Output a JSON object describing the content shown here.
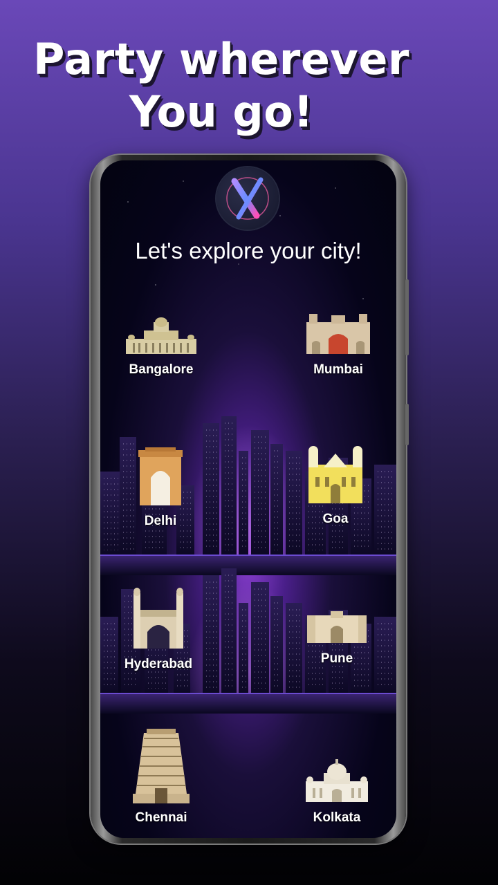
{
  "headline": {
    "line1": "Party wherever",
    "line2": "You go!"
  },
  "app": {
    "logo_icon": "x-logo-icon",
    "subtitle": "Let's explore your city!",
    "accent": "#8a3fd0"
  },
  "cities": [
    {
      "name": "Bangalore",
      "icon": "vidhana-soudha-icon"
    },
    {
      "name": "Mumbai",
      "icon": "gateway-of-india-icon"
    },
    {
      "name": "Delhi",
      "icon": "india-gate-icon"
    },
    {
      "name": "Goa",
      "icon": "goa-church-icon"
    },
    {
      "name": "Hyderabad",
      "icon": "charminar-icon"
    },
    {
      "name": "Pune",
      "icon": "shaniwar-wada-icon"
    },
    {
      "name": "Chennai",
      "icon": "temple-gopuram-icon"
    },
    {
      "name": "Kolkata",
      "icon": "victoria-memorial-icon"
    }
  ]
}
